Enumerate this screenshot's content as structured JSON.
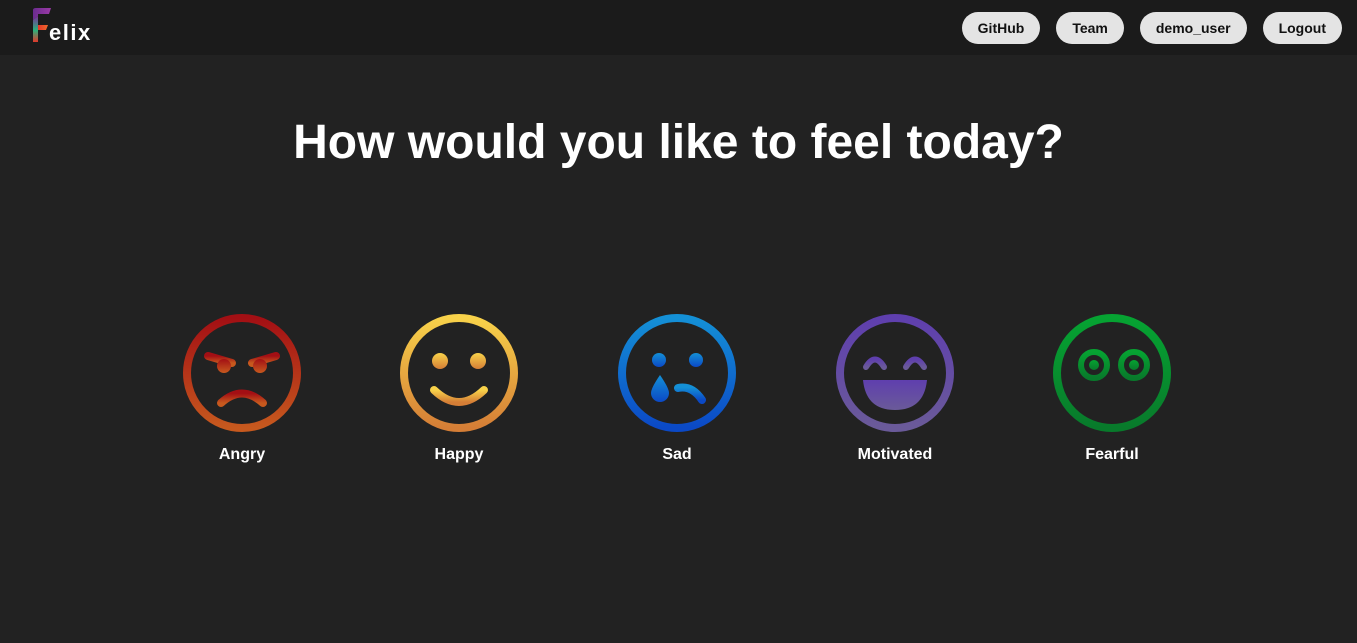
{
  "app": {
    "logo_text": "elix",
    "logo_icon": "felix-f-logo-icon"
  },
  "nav": {
    "github_label": "GitHub",
    "team_label": "Team",
    "user_label": "demo_user",
    "logout_label": "Logout"
  },
  "headline": "How would you like to feel today?",
  "moods": [
    {
      "label": "Angry",
      "icon": "angry-face-icon",
      "colors": [
        "#a30f14",
        "#c7591e"
      ]
    },
    {
      "label": "Happy",
      "icon": "happy-face-icon",
      "colors": [
        "#f8d24a",
        "#d57e36"
      ]
    },
    {
      "label": "Sad",
      "icon": "sad-face-icon",
      "colors": [
        "#1490d6",
        "#0b49c6"
      ]
    },
    {
      "label": "Motivated",
      "icon": "laughing-face-icon",
      "colors": [
        "#5f3fae",
        "#6a5a99"
      ]
    },
    {
      "label": "Fearful",
      "icon": "fearful-face-icon",
      "colors": [
        "#06a332",
        "#087a2b"
      ]
    }
  ],
  "colors": {
    "background": "#222222",
    "topbar": "#1b1b1b",
    "nav_button": "#e4e4e4"
  }
}
